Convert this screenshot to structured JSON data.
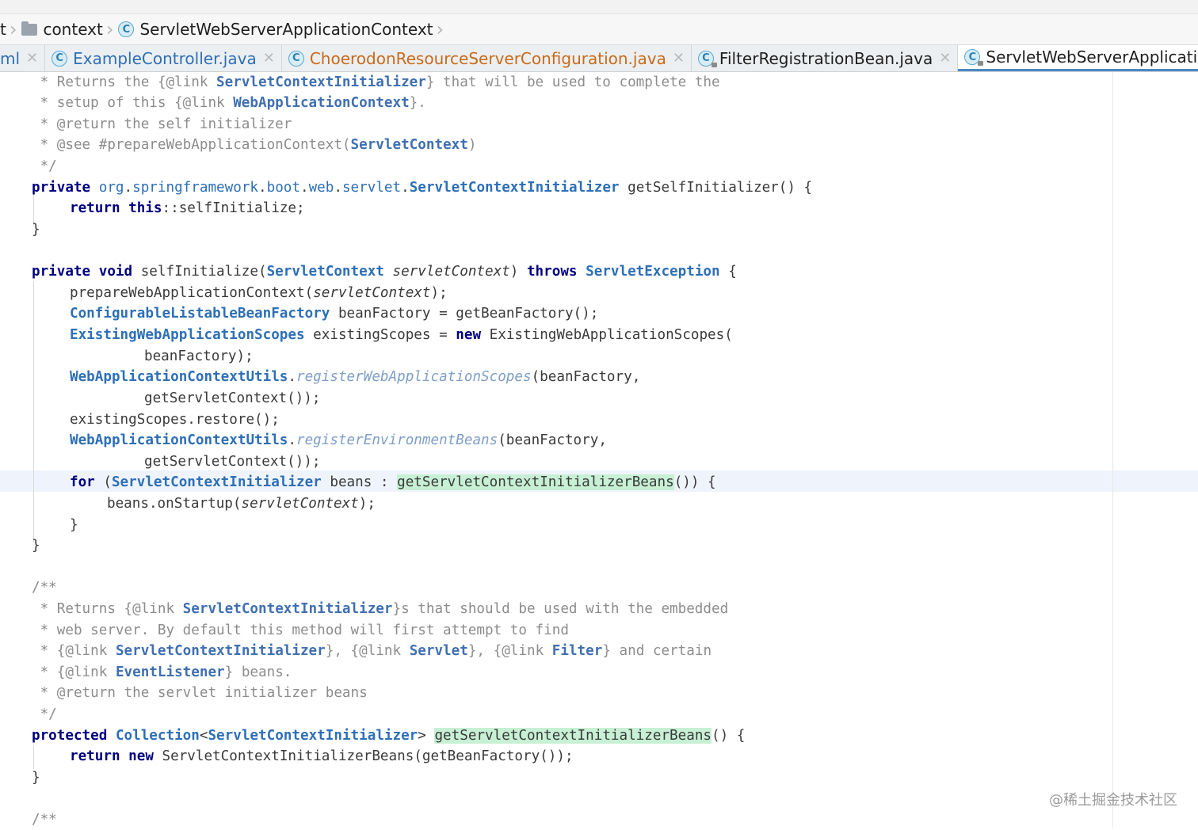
{
  "breadcrumb": {
    "lead": "t",
    "items": [
      {
        "label": "context",
        "icon": "folder-icon"
      },
      {
        "label": "ServletWebServerApplicationContext",
        "icon": "class-icon"
      }
    ]
  },
  "tabs": [
    {
      "label": "ml"
    },
    {
      "label": "ExampleController.java",
      "icon_letter": "C"
    },
    {
      "label": "ChoerodonResourceServerConfiguration.java",
      "icon_letter": "C"
    },
    {
      "label": "FilterRegistrationBean.java",
      "icon_letter": "C"
    },
    {
      "label": "ServletWebServerApplicationContext.java",
      "icon_letter": "C"
    }
  ],
  "code": {
    "l1": {
      "a": " * Returns the {@link ",
      "b": "ServletContextInitializer",
      "c": "} that will be used to complete the"
    },
    "l2": {
      "a": " * setup of this {@link ",
      "b": "WebApplicationContext",
      "c": "}."
    },
    "l3": {
      "a": " * @return the self initializer"
    },
    "l4": {
      "a": " * @see #prepareWebApplicationContext(",
      "b": "ServletContext",
      "c": ")"
    },
    "l5": {
      "a": " */"
    },
    "l6": {
      "kw": "private",
      "pkg1": "org",
      "pkg2": "springframework",
      "pkg3": "boot",
      "pkg4": "web",
      "pkg5": "servlet",
      "type": "ServletContextInitializer",
      "rest": " getSelfInitializer() {"
    },
    "l7": {
      "kw": "return",
      "kw2": "this",
      "rest": "::selfInitialize;"
    },
    "l8": {
      "text": "}"
    },
    "l10": {
      "kw": "private void",
      "name": " selfInitialize(",
      "type": "ServletContext",
      "param": "servletContext",
      "mid": ") ",
      "kw2": "throws",
      "type2": "ServletException",
      "end": " {"
    },
    "l11": {
      "a": "prepareWebApplicationContext(",
      "param": "servletContext",
      "c": ");"
    },
    "l12": {
      "type": "ConfigurableListableBeanFactory",
      "rest": " beanFactory = getBeanFactory();"
    },
    "l13": {
      "type": "ExistingWebApplicationScopes",
      "rest": " existingScopes = ",
      "kw": "new",
      "rest2": " ExistingWebApplicationScopes("
    },
    "l14": {
      "text": "beanFactory);"
    },
    "l15": {
      "type": "WebApplicationContextUtils",
      "dot": ".",
      "method": "registerWebApplicationScopes",
      "rest": "(beanFactory,"
    },
    "l16": {
      "text": "getServletContext());"
    },
    "l17": {
      "text": "existingScopes.restore();"
    },
    "l18": {
      "type": "WebApplicationContextUtils",
      "dot": ".",
      "method": "registerEnvironmentBeans",
      "rest": "(beanFactory,"
    },
    "l19": {
      "text": "getServletContext());"
    },
    "l20": {
      "kw": "for",
      "a": " (",
      "type": "ServletContextInitializer",
      "b": " beans : ",
      "hl": "getServletContextInitializerBeans",
      "c": "()) {"
    },
    "l21": {
      "a": "beans.onStartup(",
      "param": "servletContext",
      "c": ");"
    },
    "l22": {
      "text": "}"
    },
    "l23": {
      "text": "}"
    },
    "l25": {
      "text": "/**"
    },
    "l26": {
      "a": " * Returns {@link ",
      "b": "ServletContextInitializer",
      "c": "}s that should be used with the embedded"
    },
    "l27": {
      "a": " * web server. By default this method will first attempt to find"
    },
    "l28": {
      "a": " * {@link ",
      "b": "ServletContextInitializer",
      "c": "}, {@link ",
      "d": "Servlet",
      "e": "}, {@link ",
      "f": "Filter",
      "g": "} and certain"
    },
    "l29": {
      "a": " * {@link ",
      "b": "EventListener",
      "c": "} beans."
    },
    "l30": {
      "a": " * @return the servlet initializer beans"
    },
    "l31": {
      "a": " */"
    },
    "l32": {
      "kw": "protected",
      "type": "Collection",
      "lt": "<",
      "type2": "ServletContextInitializer",
      "gt": ">",
      "hl": "getServletContextInitializerBeans",
      "rest": "() {"
    },
    "l33": {
      "kw": "return new",
      "rest": " ServletContextInitializerBeans(getBeanFactory());"
    },
    "l34": {
      "text": "}"
    },
    "l36": {
      "text": "/**"
    }
  },
  "watermark": "@稀土掘金技术社区"
}
